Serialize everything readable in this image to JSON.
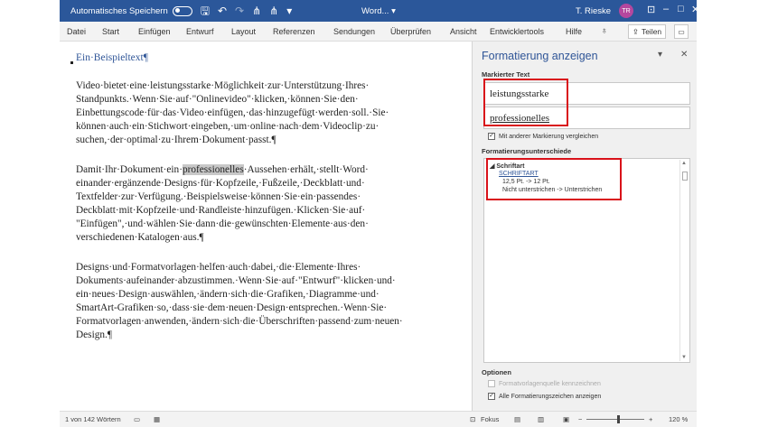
{
  "titlebar": {
    "autosave_label": "Automatisches Speichern",
    "doc_name": "Word...",
    "user_name": "T. Rieske",
    "avatar_initials": "TR"
  },
  "ribbon": {
    "tabs": [
      "Datei",
      "Start",
      "Einfügen",
      "Entwurf",
      "Layout",
      "Referenzen",
      "Sendungen",
      "Überprüfen",
      "Ansicht",
      "Entwicklertools",
      "Hilfe"
    ],
    "share_label": "Teilen"
  },
  "document": {
    "title": "Ein·Beispieltext¶",
    "p1_lines": [
      "Video·bietet·eine·leistungsstarke·Möglichkeit·zur·Unterstützung·Ihres·",
      "Standpunkts.·Wenn·Sie·auf·\"Onlinevideo\"·klicken,·können·Sie·den·",
      "Einbettungscode·für·das·Video·einfügen,·das·hinzugefügt·werden·soll.·Sie·",
      "können·auch·ein·Stichwort·eingeben,·um·online·nach·dem·Videoclip·zu·",
      "suchen,·der·optimal·zu·Ihrem·Dokument·passt.¶"
    ],
    "p2_line1_pre": "Damit·Ihr·Dokument·ein·",
    "p2_line1_hl": "professionelles",
    "p2_line1_post": "·Aussehen·erhält,·stellt·Word·",
    "p2_lines": [
      "einander·ergänzende·Designs·für·Kopfzeile,·Fußzeile,·Deckblatt·und·",
      "Textfelder·zur·Verfügung.·Beispielsweise·können·Sie·ein·passendes·",
      "Deckblatt·mit·Kopfzeile·und·Randleiste·hinzufügen.·Klicken·Sie·auf·",
      "\"Einfügen\",·und·wählen·Sie·dann·die·gewünschten·Elemente·aus·den·",
      "verschiedenen·Katalogen·aus.¶"
    ],
    "p3_lines": [
      "Designs·und·Formatvorlagen·helfen·auch·dabei,·die·Elemente·Ihres·",
      "Dokuments·aufeinander·abzustimmen.·Wenn·Sie·auf·\"Entwurf\"·klicken·und·",
      "ein·neues·Design·auswählen,·ändern·sich·die·Grafiken,·Diagramme·und·",
      "SmartArt-Grafiken·so,·dass·sie·dem·neuen·Design·entsprechen.·Wenn·Sie·",
      "Formatvorlagen·anwenden,·ändern·sich·die·Überschriften·passend·zum·neuen·",
      "Design.¶"
    ]
  },
  "panel": {
    "title": "Formatierung anzeigen",
    "marked_label": "Markierter Text",
    "box1": "leistungsstarke",
    "box2": "professionelles",
    "compare_label": "Mit anderer Markierung vergleichen",
    "diff_label": "Formatierungsunterschiede",
    "section": "Schriftart",
    "link": "SCHRIFTART",
    "diff1": "12,5 Pt. -> 12 Pt.",
    "diff2": "Nicht unterstrichen -> Unterstrichen",
    "options_label": "Optionen",
    "opt1": "Formatvorlagenquelle kennzeichnen",
    "opt2": "Alle Formatierungszeichen anzeigen"
  },
  "status": {
    "words": "1 von 142 Wörtern",
    "focus": "Fokus",
    "zoom": "120 %",
    "zoom_level_percent": 120
  },
  "colors": {
    "titlebar": "#2b579a",
    "highlight_red": "#d9121a",
    "heading_blue": "#2f5597"
  }
}
